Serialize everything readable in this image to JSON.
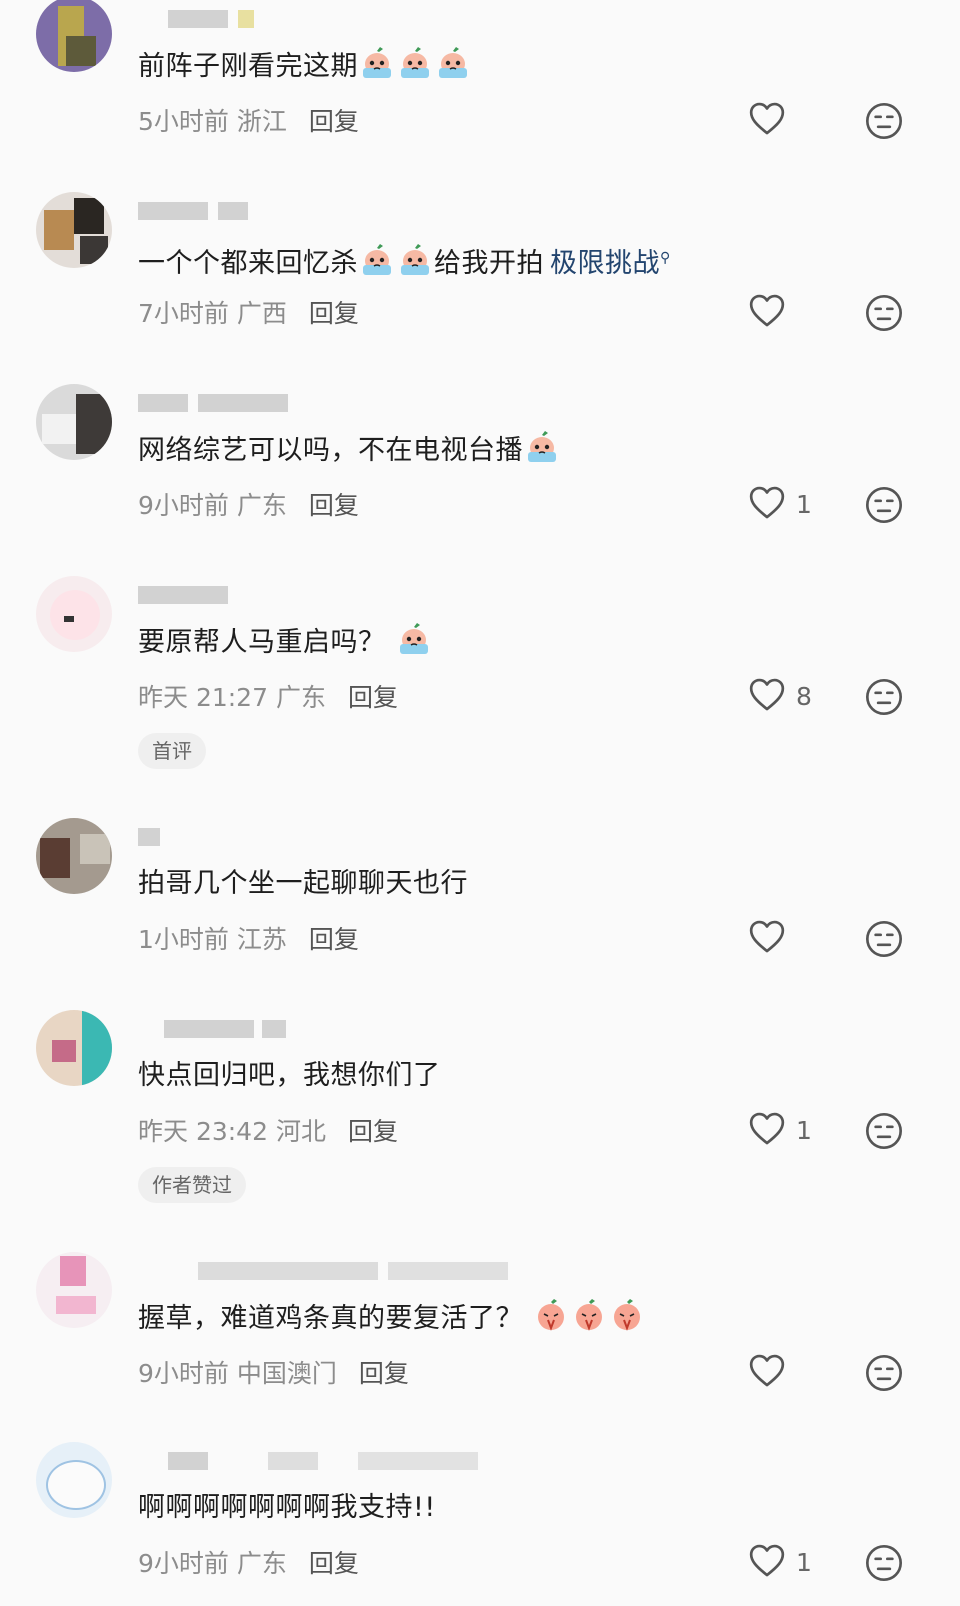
{
  "comments": [
    {
      "text": "前阵子刚看完这期",
      "emoji_count": 3,
      "emoji": "crying-peach-emoji",
      "link": "",
      "time": "5小时前",
      "location": "浙江",
      "reply": "回复",
      "likes": "",
      "tag": ""
    },
    {
      "text": "一个个都来回忆杀",
      "emoji_count": 2,
      "emoji": "crying-peach-emoji",
      "text_after": "给我开拍",
      "link": "极限挑战",
      "time": "7小时前",
      "location": "广西",
      "reply": "回复",
      "likes": "",
      "tag": ""
    },
    {
      "text": "网络综艺可以吗，不在电视台播",
      "emoji_count": 1,
      "emoji": "crying-peach-emoji",
      "link": "",
      "time": "9小时前",
      "location": "广东",
      "reply": "回复",
      "likes": "1",
      "tag": ""
    },
    {
      "text": "要原帮人马重启吗？",
      "emoji_count": 1,
      "emoji": "crying-peach-emoji",
      "link": "",
      "time": "昨天 21:27",
      "location": "广东",
      "reply": "回复",
      "likes": "8",
      "tag": "首评"
    },
    {
      "text": "拍哥几个坐一起聊聊天也行",
      "emoji_count": 0,
      "emoji": "",
      "link": "",
      "time": "1小时前",
      "location": "江苏",
      "reply": "回复",
      "likes": "",
      "tag": ""
    },
    {
      "text": "快点回归吧，我想你们了",
      "emoji_count": 0,
      "emoji": "",
      "link": "",
      "time": "昨天 23:42",
      "location": "河北",
      "reply": "回复",
      "likes": "1",
      "tag": "作者赞过"
    },
    {
      "text": "握草，难道鸡条真的要复活了？",
      "emoji_count": 3,
      "emoji": "praying-peach-emoji",
      "link": "",
      "time": "9小时前",
      "location": "中国澳门",
      "reply": "回复",
      "likes": "",
      "tag": ""
    },
    {
      "text": "啊啊啊啊啊啊啊我支持!!",
      "emoji_count": 0,
      "emoji": "",
      "link": "",
      "time": "9小时前",
      "location": "广东",
      "reply": "回复",
      "likes": "1",
      "tag": ""
    }
  ],
  "colors": {
    "link": "#23456f",
    "meta": "#8c8c8c",
    "background": "#fafafa"
  },
  "icons": {
    "like": "heart-outline-icon",
    "dislike": "meh-face-icon"
  }
}
